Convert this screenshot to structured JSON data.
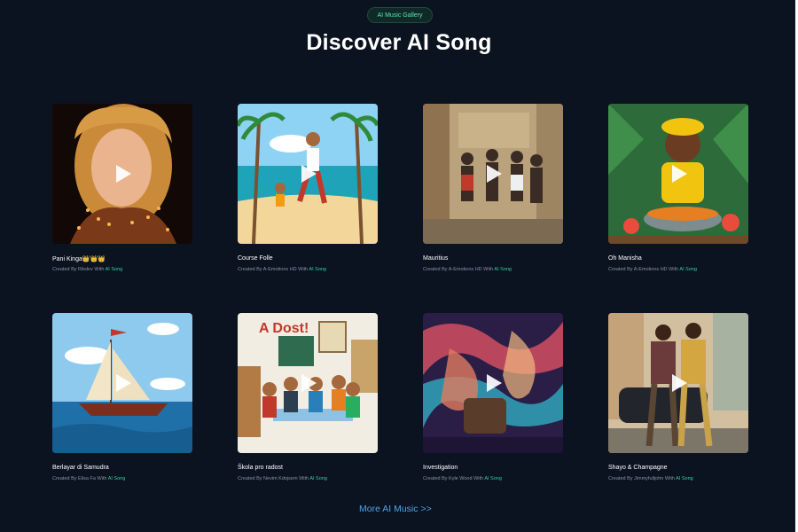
{
  "badge": "AI Music Gallery",
  "title": "Discover AI Song",
  "more_link": "More AI Music  >>",
  "colors": {
    "background": "#0b1220",
    "brand_green": "#34d399",
    "link_blue": "#4ea6e8"
  },
  "songs": [
    {
      "title": "Pani Kinga👑👑👑",
      "created_prefix": "Created By ",
      "author": "Rikdev",
      "created_mid": " With ",
      "brand": "AI Song"
    },
    {
      "title": "Course Folle",
      "created_prefix": "Created By ",
      "author": "A-Emotions HD",
      "created_mid": " With ",
      "brand": "AI Song"
    },
    {
      "title": "Mauritius",
      "created_prefix": "Created By ",
      "author": "A-Emotions HD",
      "created_mid": " With ",
      "brand": "AI Song"
    },
    {
      "title": "Oh Manisha",
      "created_prefix": "Created By ",
      "author": "A-Emotions HD",
      "created_mid": " With ",
      "brand": "AI Song"
    },
    {
      "title": "Berlayar di Samudra",
      "created_prefix": "Created By ",
      "author": "Elisa Fa",
      "created_mid": " With ",
      "brand": "AI Song"
    },
    {
      "title": "Škola pro radost",
      "created_prefix": "Created By ",
      "author": "Nevim Kdojsem",
      "created_mid": " With ",
      "brand": "AI Song"
    },
    {
      "title": "Investigation",
      "created_prefix": "Created By ",
      "author": "Kyle Wood",
      "created_mid": " With ",
      "brand": "AI Song"
    },
    {
      "title": "Shayo & Champagne",
      "created_prefix": "Created By ",
      "author": "Jimmyfulljohn",
      "created_mid": " With ",
      "brand": "AI Song"
    }
  ]
}
